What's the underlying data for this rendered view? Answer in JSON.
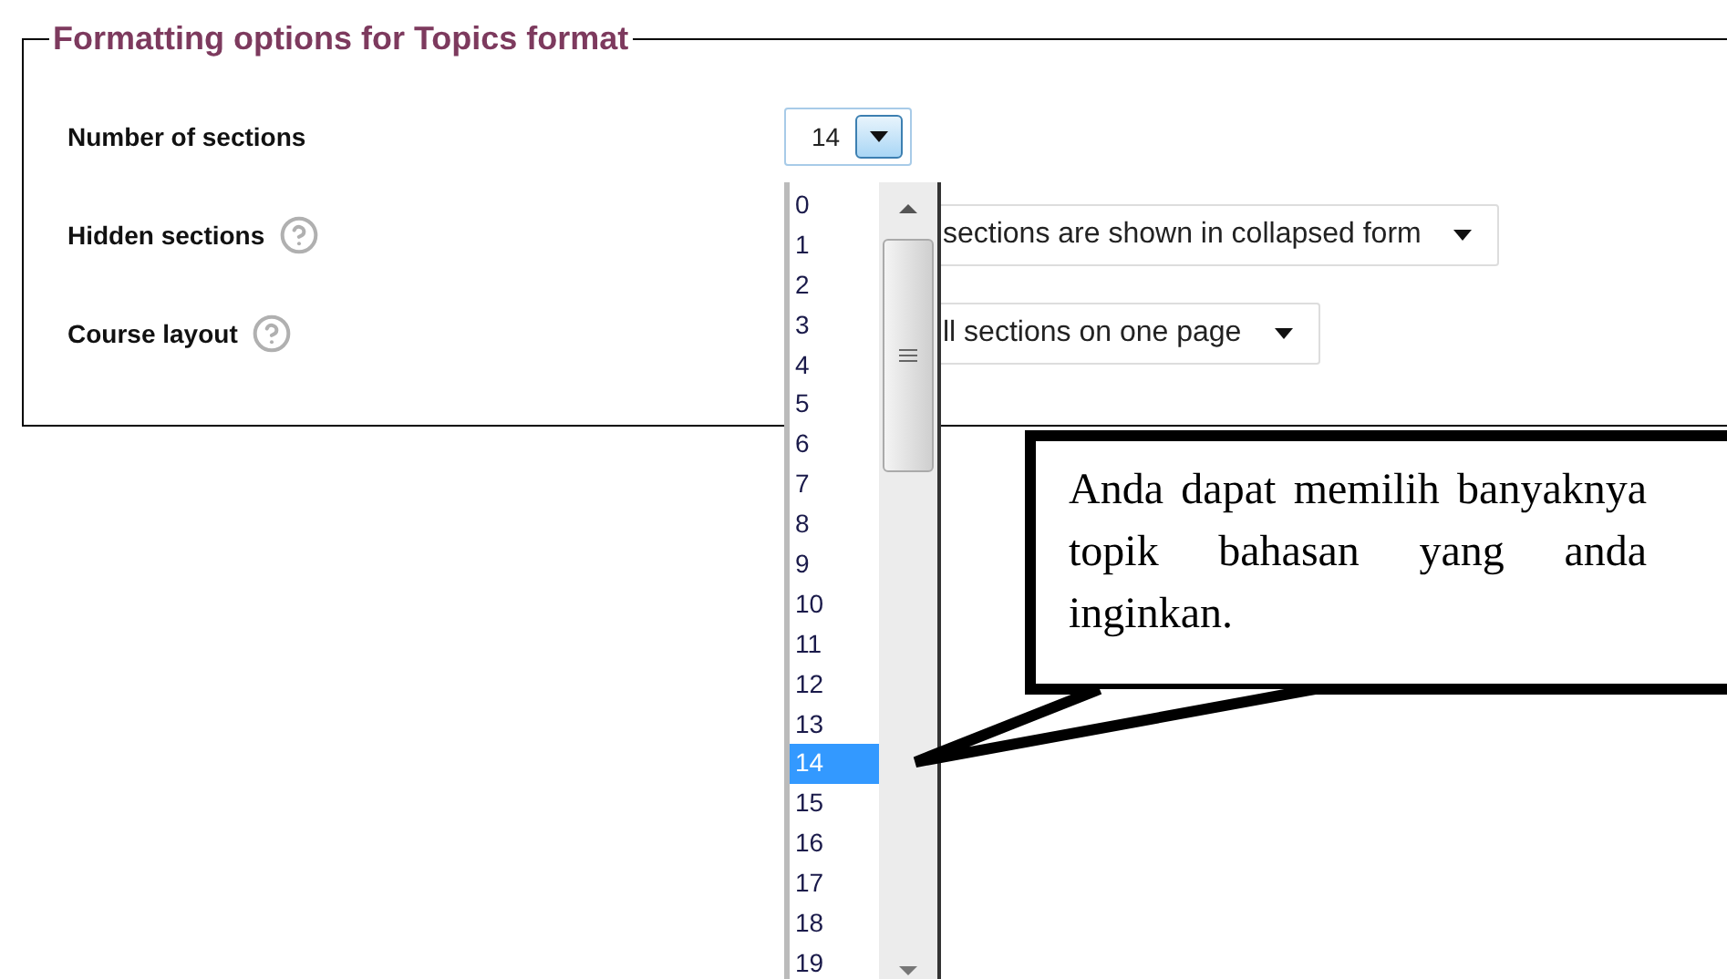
{
  "legend": "Formatting options for Topics format",
  "fields": [
    {
      "label": "Number of sections",
      "help": false,
      "open": true,
      "value": "14"
    },
    {
      "label": "Hidden sections",
      "help": true,
      "open": false,
      "value": "sections are shown in collapsed form"
    },
    {
      "label": "Course layout",
      "help": true,
      "open": false,
      "value": "ll sections on one page"
    }
  ],
  "dropdown": {
    "options": [
      {
        "label": "0",
        "selected": false
      },
      {
        "label": "1",
        "selected": false
      },
      {
        "label": "2",
        "selected": false
      },
      {
        "label": "3",
        "selected": false
      },
      {
        "label": "4",
        "selected": false
      },
      {
        "label": "5",
        "selected": false
      },
      {
        "label": "6",
        "selected": false
      },
      {
        "label": "7",
        "selected": false
      },
      {
        "label": "8",
        "selected": false
      },
      {
        "label": "9",
        "selected": false
      },
      {
        "label": "10",
        "selected": false
      },
      {
        "label": "11",
        "selected": false
      },
      {
        "label": "12",
        "selected": false
      },
      {
        "label": "13",
        "selected": false
      },
      {
        "label": "14",
        "selected": true
      },
      {
        "label": "15",
        "selected": false
      },
      {
        "label": "16",
        "selected": false
      },
      {
        "label": "17",
        "selected": false
      },
      {
        "label": "18",
        "selected": false
      },
      {
        "label": "19",
        "selected": false
      }
    ]
  },
  "callout": {
    "text": "Anda dapat memilih banyaknya topik bahasan yang anda inginkan."
  }
}
